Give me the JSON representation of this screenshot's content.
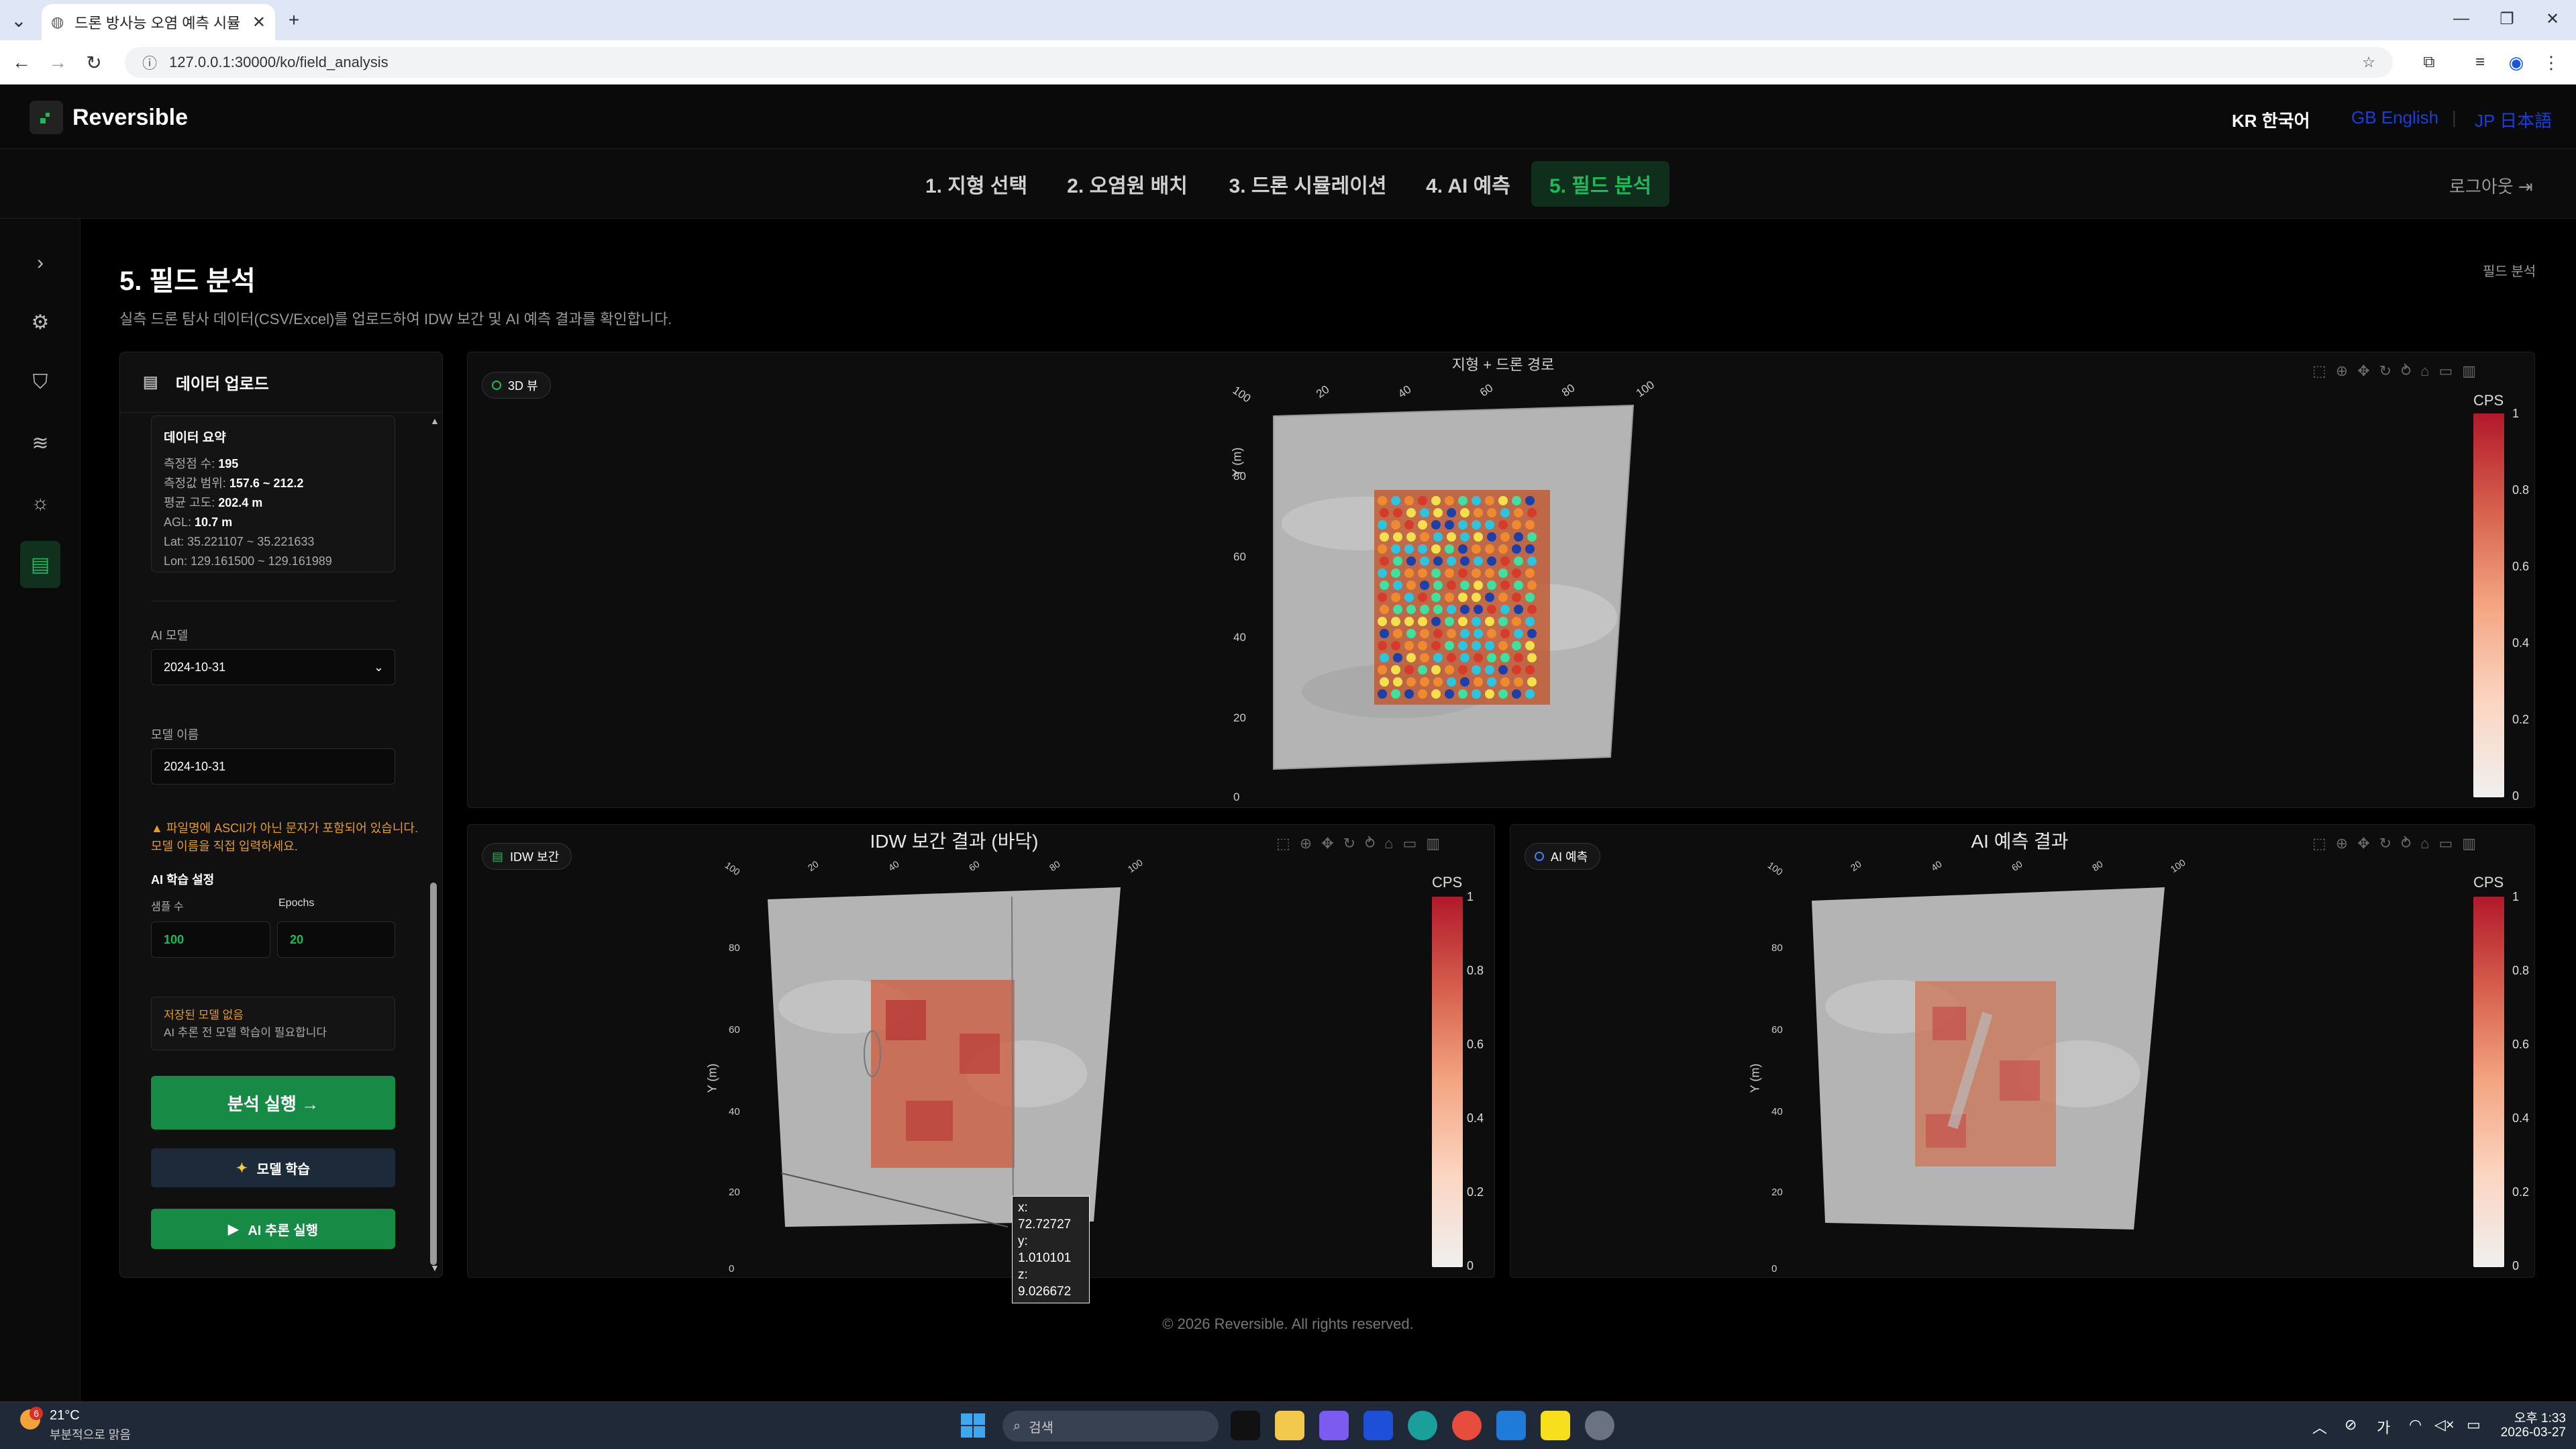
{
  "browser": {
    "tab_title": "드론 방사능 오염 예측 시뮬레이",
    "url": "127.0.0.1:30000/ko/field_analysis"
  },
  "header": {
    "brand": "Reversible",
    "lang_ko": "KR 한국어",
    "lang_en": "GB English",
    "lang_jp": "JP 日本語",
    "logout": "로그아웃"
  },
  "nav": {
    "tabs": [
      {
        "label": "1. 지형 선택"
      },
      {
        "label": "2. 오염원 배치"
      },
      {
        "label": "3. 드론 시뮬레이션"
      },
      {
        "label": "4. AI 예측"
      },
      {
        "label": "5. 필드 분석"
      }
    ]
  },
  "page": {
    "title": "5. 필드 분석",
    "description": "실측 드론 탐사 데이터(CSV/Excel)를 업로드하여 IDW 보간 및 AI 예측 결과를 확인합니다.",
    "breadcrumb": "필드 분석"
  },
  "left_panel": {
    "header": "데이터 업로드",
    "summary": {
      "title": "데이터 요약",
      "count_label": "측정점 수:",
      "count_value": "195",
      "range_label": "측정값 범위:",
      "range_value": "157.6 ~ 212.2",
      "alt_label": "평균 고도:",
      "alt_value": "202.4 m",
      "agl_label": "AGL:",
      "agl_value": "10.7 m",
      "lat": "Lat: 35.221107 ~ 35.221633",
      "lon": "Lon: 129.161500 ~ 129.161989"
    },
    "ai_model_label": "AI 모델",
    "ai_model_value": "2024-10-31",
    "model_name_label": "모델 이름",
    "model_name_value": "2024-10-31",
    "warning": "파일명에 ASCII가 아닌 문자가 포함되어 있습니다. 모델 이름을 직접 입력하세요.",
    "train_settings": "AI 학습 설정",
    "samples_label": "샘플 수",
    "samples_value": "100",
    "epochs_label": "Epochs",
    "epochs_value": "20",
    "no_model": "저장된 모델 없음",
    "no_model_desc": "AI 추론 전 모델 학습이 필요합니다",
    "run_button": "분석 실행 →",
    "train_button": "모델 학습",
    "infer_button": "AI 추론 실행"
  },
  "panels": {
    "top": {
      "badge": "3D 뷰",
      "title": "지형 + 드론 경로",
      "colorbar_title": "CPS",
      "colorbar_ticks": [
        "1",
        "0.8",
        "0.6",
        "0.4",
        "0.2",
        "0"
      ],
      "x_ticks": [
        "100",
        "20",
        "40",
        "60",
        "80",
        "100"
      ],
      "y_ticks": [
        "80",
        "60",
        "40",
        "20",
        "0"
      ],
      "y_label": "Y (m)"
    },
    "idw": {
      "badge": "IDW 보간",
      "title": "IDW 보간 결과 (바닥)",
      "colorbar_title": "CPS",
      "colorbar_ticks": [
        "1",
        "0.8",
        "0.6",
        "0.4",
        "0.2",
        "0"
      ],
      "x_ticks": [
        "100",
        "20",
        "40",
        "60",
        "80",
        "100"
      ],
      "y_ticks": [
        "80",
        "60",
        "40",
        "20",
        "0"
      ],
      "y_label": "Y (m)",
      "tooltip": [
        "x: 72.72727",
        "y: 1.010101",
        "z: 9.026672"
      ]
    },
    "ai": {
      "badge": "AI 예측",
      "title": "AI 예측 결과",
      "colorbar_title": "CPS",
      "colorbar_ticks": [
        "1",
        "0.8",
        "0.6",
        "0.4",
        "0.2",
        "0"
      ],
      "x_ticks": [
        "100",
        "20",
        "40",
        "60",
        "80",
        "100"
      ],
      "y_ticks": [
        "80",
        "60",
        "40",
        "20",
        "0"
      ],
      "y_label": "Y (m)"
    }
  },
  "footer": "© 2026 Reversible. All rights reserved.",
  "taskbar": {
    "weather_temp": "21°C",
    "weather_desc": "부분적으로 맑음",
    "weather_badge": "6",
    "search_placeholder": "검색",
    "ime": "가",
    "time": "오후 1:33",
    "date": "2026-03-27"
  }
}
